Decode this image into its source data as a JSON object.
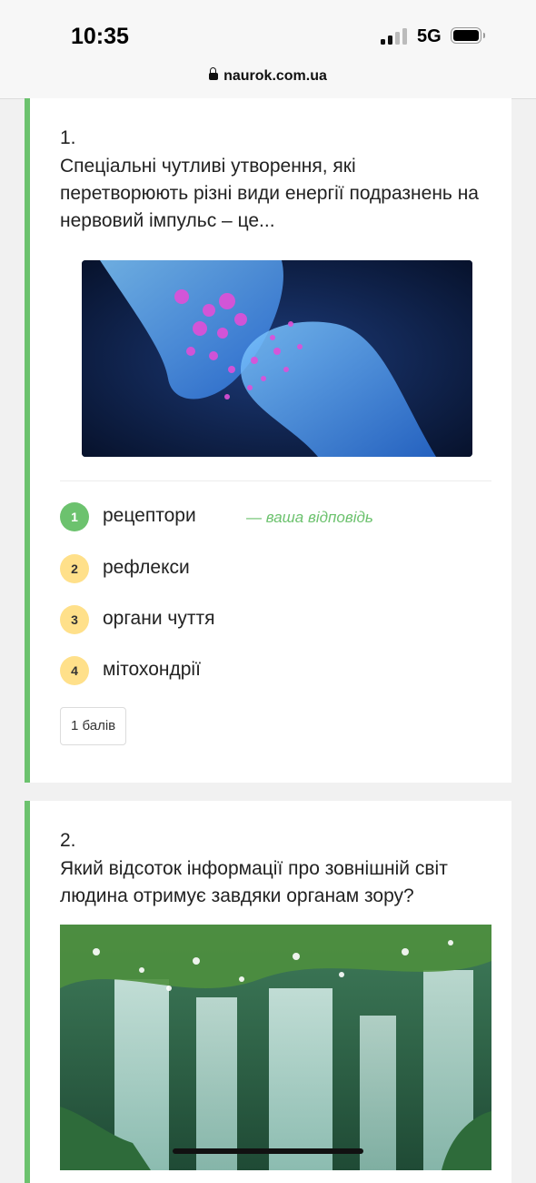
{
  "status": {
    "time": "10:35",
    "network": "5G"
  },
  "browser": {
    "url": "naurok.com.ua"
  },
  "question1": {
    "number": "1.",
    "text": "Спеціальні чутливі утворення, які перетворюють різні види енергії подразнень на нервовий імпульс – це...",
    "image_icon": "synapse-illustration",
    "options": [
      {
        "num": "1",
        "label": "рецептори",
        "selected": true
      },
      {
        "num": "2",
        "label": "рефлекси"
      },
      {
        "num": "3",
        "label": "органи чуття"
      },
      {
        "num": "4",
        "label": "мітохондрії"
      }
    ],
    "your_answer_label": "— ваша відповідь",
    "points": "1 балів"
  },
  "question2": {
    "number": "2.",
    "text": "Який відсоток інформації про зовнішній світ людина отримує завдяки органам зору?",
    "image_icon": "waterfall-photo"
  },
  "colors": {
    "accent_green": "#6cc26e",
    "option_yellow": "#ffe08a"
  }
}
